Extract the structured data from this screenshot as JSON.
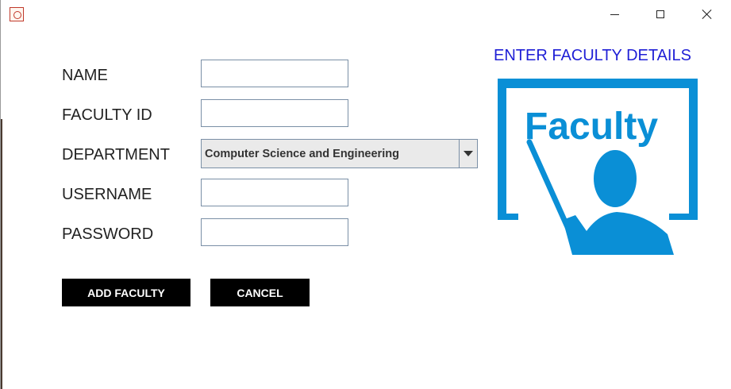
{
  "titlebar": {
    "app_icon": "app-icon",
    "minimize_icon": "minimize-icon",
    "maximize_icon": "maximize-icon",
    "close_icon": "close-icon"
  },
  "form": {
    "name_label": "NAME",
    "faculty_id_label": "FACULTY ID",
    "department_label": "DEPARTMENT",
    "username_label": "USERNAME",
    "password_label": "PASSWORD",
    "name_value": "",
    "faculty_id_value": "",
    "username_value": "",
    "password_value": "",
    "department_selected": "Computer Science and Engineering",
    "add_button": "ADD FACULTY",
    "cancel_button": "CANCEL"
  },
  "side": {
    "heading": "ENTER FACULTY DETAILS",
    "logo_text": "Faculty"
  },
  "colors": {
    "heading": "#1f1fd6",
    "logo_blue": "#0a8fd6",
    "button_bg": "#000000",
    "button_text": "#ffffff"
  }
}
